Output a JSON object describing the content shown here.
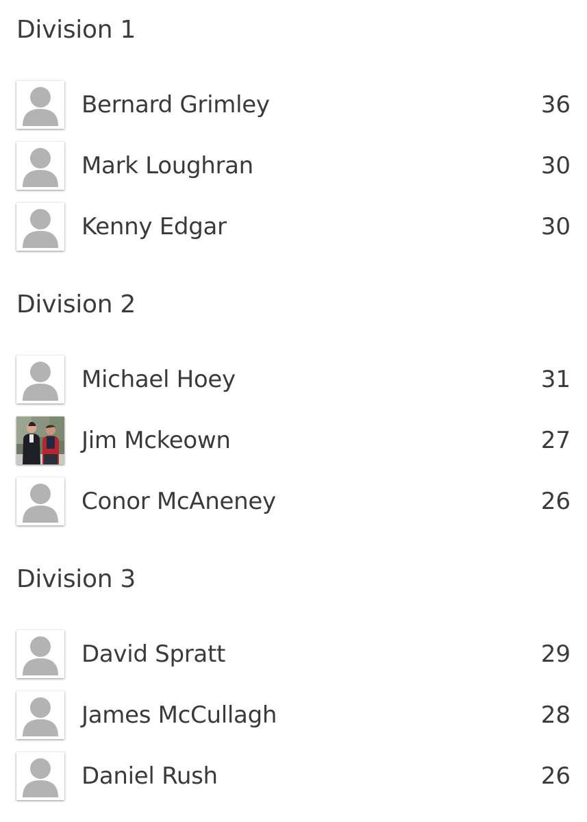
{
  "divisions": [
    {
      "title": "Division 1",
      "players": [
        {
          "name": "Bernard Grimley",
          "score": "36",
          "avatar": "default-avatar-icon"
        },
        {
          "name": "Mark Loughran",
          "score": "30",
          "avatar": "default-avatar-icon"
        },
        {
          "name": "Kenny Edgar",
          "score": "30",
          "avatar": "default-avatar-icon"
        }
      ]
    },
    {
      "title": "Division 2",
      "players": [
        {
          "name": "Michael Hoey",
          "score": "31",
          "avatar": "default-avatar-icon"
        },
        {
          "name": "Jim Mckeown",
          "score": "27",
          "avatar": "photo"
        },
        {
          "name": "Conor McAneney",
          "score": "26",
          "avatar": "default-avatar-icon"
        }
      ]
    },
    {
      "title": "Division 3",
      "players": [
        {
          "name": "David Spratt",
          "score": "29",
          "avatar": "default-avatar-icon"
        },
        {
          "name": "James McCullagh",
          "score": "28",
          "avatar": "default-avatar-icon"
        },
        {
          "name": "Daniel Rush",
          "score": "26",
          "avatar": "default-avatar-icon"
        }
      ]
    }
  ],
  "colors": {
    "text": "#3a3a3a",
    "placeholder_avatar": "#b3b3b3"
  }
}
